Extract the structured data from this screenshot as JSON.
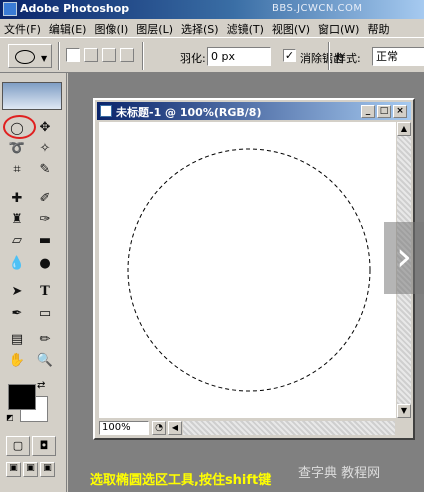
{
  "app": {
    "title": "Adobe Photoshop",
    "watermark": "BBS.JCWCN.COM"
  },
  "menu": [
    "文件(F)",
    "编辑(E)",
    "图像(I)",
    "图层(L)",
    "选择(S)",
    "滤镜(T)",
    "视图(V)",
    "窗口(W)",
    "帮助"
  ],
  "options": {
    "feather_label": "羽化:",
    "feather_value": "0 px",
    "antialias_checked": true,
    "antialias_label": "消除锯齿",
    "style_label": "样式:",
    "style_value": "正常"
  },
  "document": {
    "title": "未标题-1 @ 100%(RGB/8)",
    "zoom": "100%",
    "controls": {
      "minimize": "_",
      "maximize": "□",
      "close": "×"
    }
  },
  "toolbox": {
    "tools": [
      "ellipse-marquee-icon",
      "move-icon",
      "lasso-icon",
      "magic-wand-icon",
      "crop-icon",
      "slice-icon",
      "healing-brush-icon",
      "brush-icon",
      "clone-stamp-icon",
      "history-brush-icon",
      "eraser-icon",
      "gradient-icon",
      "blur-icon",
      "dodge-icon",
      "path-selection-icon",
      "type-icon",
      "pen-icon",
      "rectangle-icon",
      "notes-icon",
      "eyedropper-icon",
      "hand-icon",
      "zoom-icon"
    ],
    "foreground": "#000000",
    "background": "#ffffff"
  },
  "caption": "选取椭圆选区工具,按住shift键",
  "site_watermark": "查字典 教程网"
}
